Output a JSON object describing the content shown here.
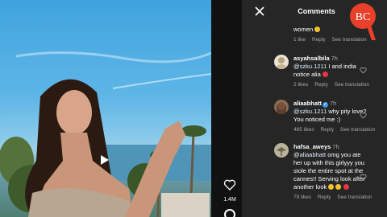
{
  "video": {
    "like_count": "1.4M"
  },
  "panel": {
    "title": "Comments",
    "logo_text": "BC"
  },
  "comments": [
    {
      "text": "women",
      "likes": "1 like",
      "reply_label": "Reply",
      "translation_label": "See translation"
    },
    {
      "username": "asyahsalbila",
      "time": "7h",
      "mention": "@szku.1211",
      "text": " I and india notice alia",
      "likes": "2 likes",
      "reply_label": "Reply",
      "translation_label": "See translation"
    },
    {
      "username": "aliaabhatt",
      "time": "7h",
      "mention": "@szku.1211",
      "text": " why pity love? You noticed me :)",
      "likes": "485 likes",
      "reply_label": "Reply",
      "translation_label": "See translation"
    },
    {
      "username": "hafsa_aweys",
      "time": "7h",
      "mention": "@aliaabhatt",
      "text": " omg you ate her up with this girlyyy you stole the entire spot at the cannes!! Serving look after another look",
      "likes": "79 likes",
      "reply_label": "Reply",
      "translation_label": "See translation"
    }
  ],
  "colors": {
    "panel_bg": "#262626",
    "meta_text": "#a8a8a8",
    "verified": "#3897f0",
    "logo": "#e8402a"
  },
  "icons": [
    "close-icon",
    "heart-icon",
    "comment-icon",
    "play-icon",
    "verified-icon",
    "like-icon"
  ]
}
